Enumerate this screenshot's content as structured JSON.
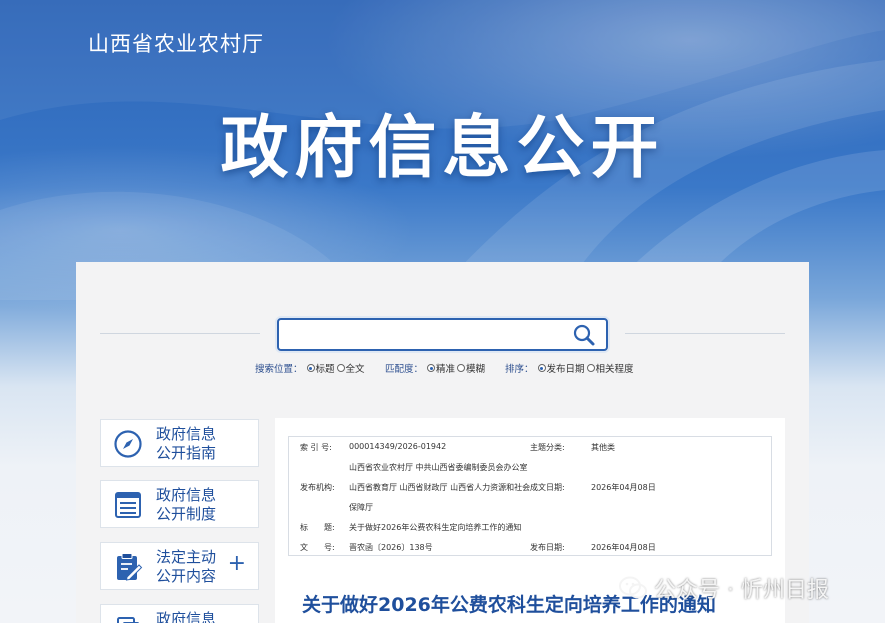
{
  "header": {
    "dept_name": "山西省农业农村厅",
    "main_title": "政府信息公开"
  },
  "search": {
    "placeholder": "",
    "position_label": "搜索位置：",
    "position_options": [
      "标题",
      "全文"
    ],
    "match_label": "匹配度：",
    "match_options": [
      "精准",
      "模糊"
    ],
    "sort_label": "排序：",
    "sort_options": [
      "发布日期",
      "相关程度"
    ]
  },
  "sidebar": {
    "items": [
      {
        "line1": "政府信息",
        "line2": "公开指南",
        "icon": "compass-icon"
      },
      {
        "line1": "政府信息",
        "line2": "公开制度",
        "icon": "document-list-icon"
      },
      {
        "line1": "法定主动",
        "line2": "公开内容",
        "icon": "clipboard-edit-icon",
        "expand": "+"
      },
      {
        "line1": "政府信息",
        "line2": "",
        "icon": "document-icon"
      }
    ]
  },
  "meta": {
    "index_label": "索 引 号:",
    "index_value": "000014349/2026-01942",
    "category_label": "主题分类:",
    "category_value": "其他类",
    "publisher_line1": "山西省农业农村厅 中共山西省委编制委员会办公室",
    "publisher_label": "发布机构:",
    "publisher_line2": "山西省教育厅 山西省财政厅 山西省人力资源和社会",
    "created_label": "成文日期:",
    "created_value": "2026年04月08日",
    "publisher_line3": "保障厅",
    "title_label": "标　　题:",
    "title_value": "关于做好2026年公费农科生定向培养工作的通知",
    "docno_label": "文　　号:",
    "docno_value": "晋农函〔2026〕138号",
    "pubdate_label": "发布日期:",
    "pubdate_value": "2026年04月08日"
  },
  "document": {
    "title": "关于做好2026年公费农科生定向培养工作的通知"
  },
  "watermark": {
    "text": "公众号 · 忻州日报"
  },
  "colors": {
    "brand_blue": "#2d62b0",
    "title_blue": "#1f4f9c"
  }
}
